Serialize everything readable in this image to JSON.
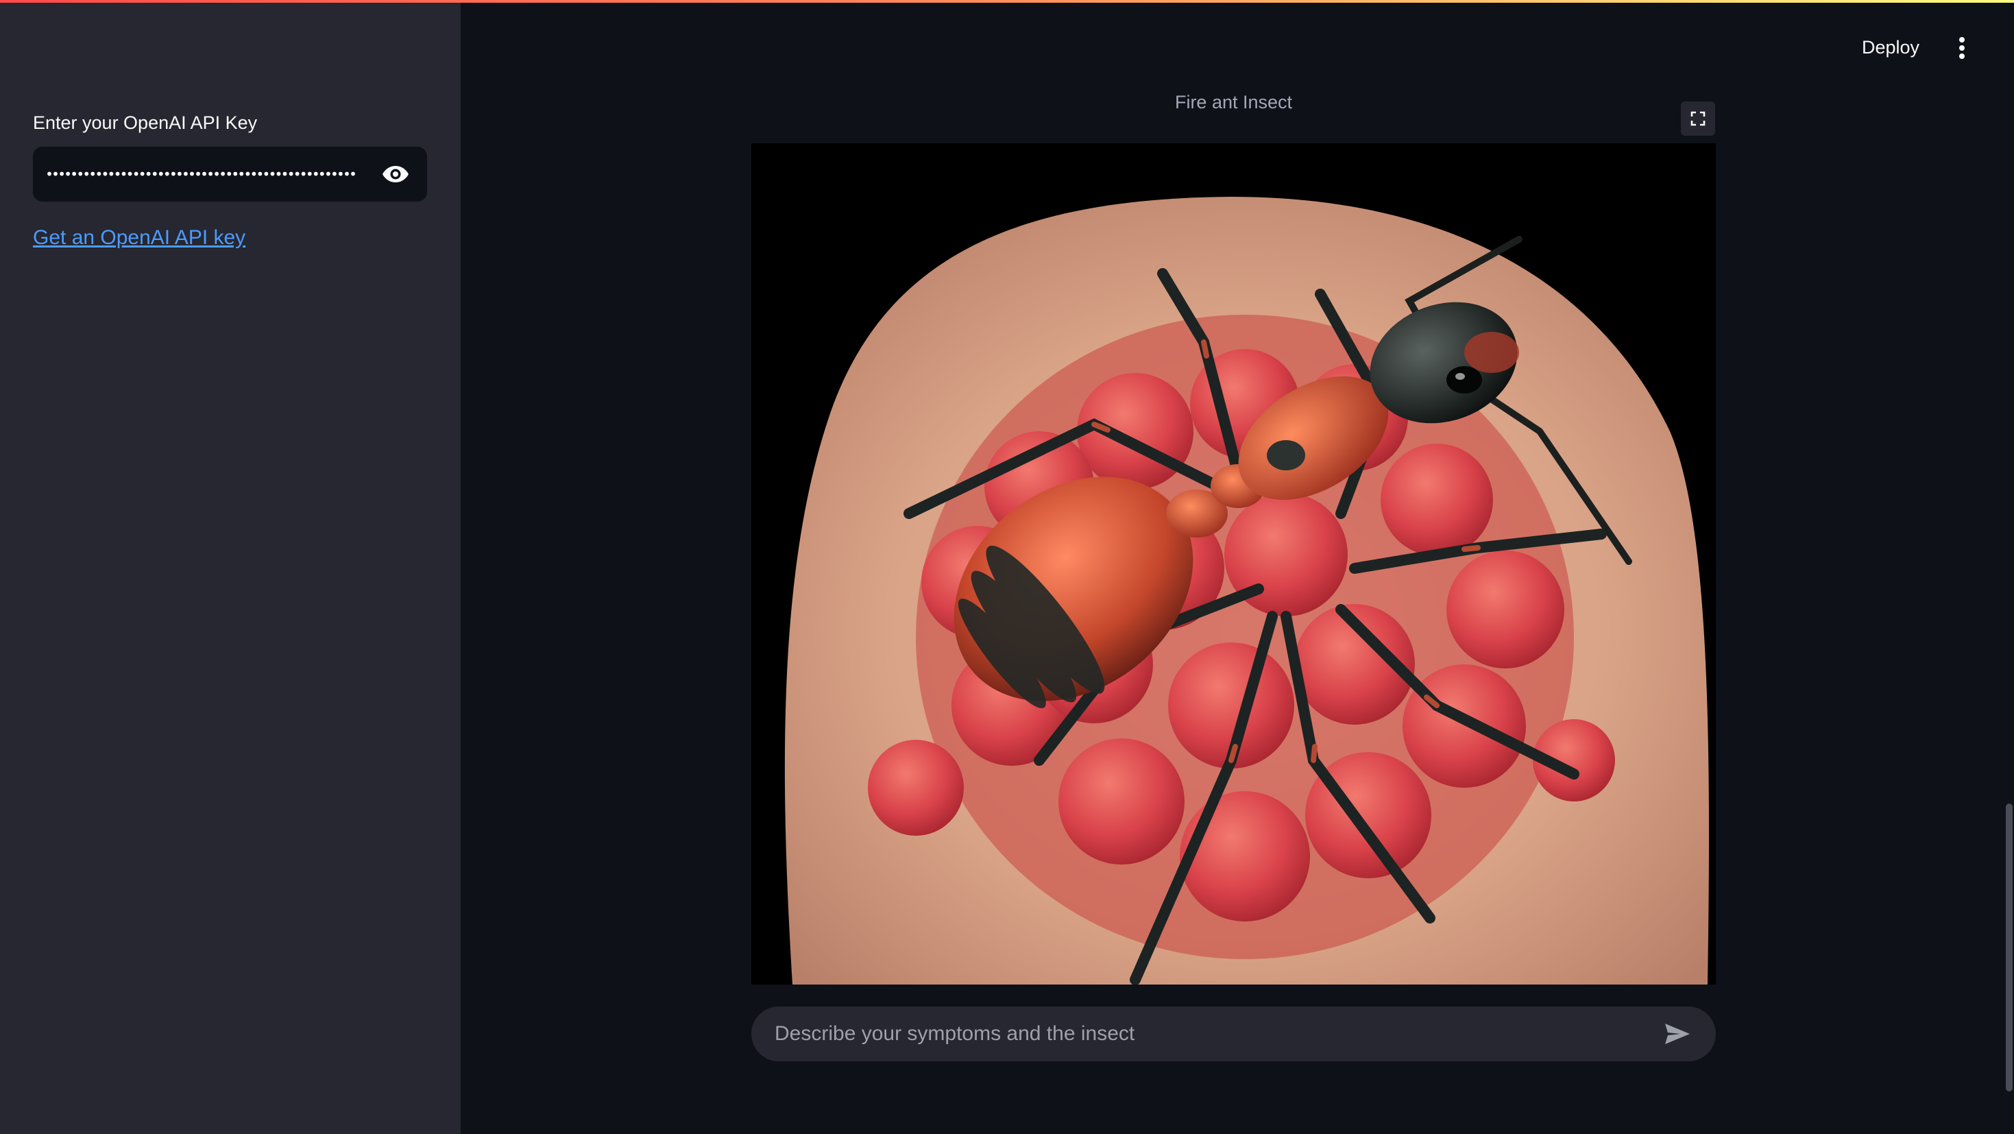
{
  "sidebar": {
    "api_key_label": "Enter your OpenAI API Key",
    "api_key_masked": "••••••••••••••••••••••••••••••••••••••••••••••••••",
    "api_key_link": "Get an OpenAI API key",
    "toggle_icon": "eye-icon"
  },
  "header": {
    "deploy_label": "Deploy",
    "menu_icon": "kebab-menu-icon"
  },
  "main": {
    "image_caption": "Fire ant Insect",
    "fullscreen_icon": "fullscreen-icon",
    "chat_placeholder": "Describe your symptoms and the insect",
    "send_icon": "send-icon"
  },
  "colors": {
    "sidebar_bg": "#262730",
    "main_bg": "#0e1117",
    "link": "#4c9bff",
    "accent": "#ff4b4b"
  }
}
